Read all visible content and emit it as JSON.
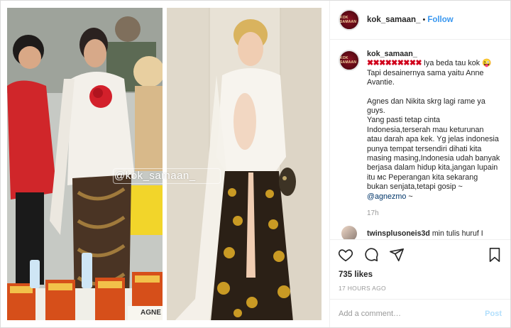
{
  "account": {
    "username": "kok_samaan_",
    "follow_label": "Follow",
    "separator": "•",
    "avatar_text": "KOK SAMAAN"
  },
  "media": {
    "watermark": "@kok_samaan_",
    "left_photo_label": "AGNE"
  },
  "caption": {
    "username": "kok_samaan_",
    "prefix_marks": "✖✖✖✖✖✖✖✖✖",
    "line1": " Iya beda tau kok 😜",
    "line2": "Tapi desainernya sama yaitu Anne Avantie.",
    "line3": "Agnes dan Nikita skrg lagi rame ya guys.",
    "line4": "Yang pasti tetap cinta Indonesia,terserah mau keturunan atau darah apa kek. Yg jelas indonesia punya tempat tersendiri dihati kita masing masing,Indonesia udah banyak berjasa dalam hidup kita,jangan lupain itu ᴍᴄ Peperangan kita sekarang bukan senjata,tetapi gosip ~",
    "mention": "@agnezmo",
    "mention_suffix": " ~",
    "time": "17h"
  },
  "reply": {
    "username": "twinsplusoneis3d",
    "text": " min tulis huruf I"
  },
  "stats": {
    "likes": "735 likes",
    "posted": "17 HOURS AGO"
  },
  "comment_box": {
    "placeholder": "Add a comment…",
    "post_label": "Post"
  },
  "icons": {
    "more": "more-icon",
    "like": "heart-icon",
    "comment": "comment-icon",
    "share": "share-icon",
    "save": "bookmark-icon"
  },
  "colors": {
    "follow": "#3897f0",
    "post_disabled": "#b2dffc",
    "marks": "#d0021b"
  }
}
